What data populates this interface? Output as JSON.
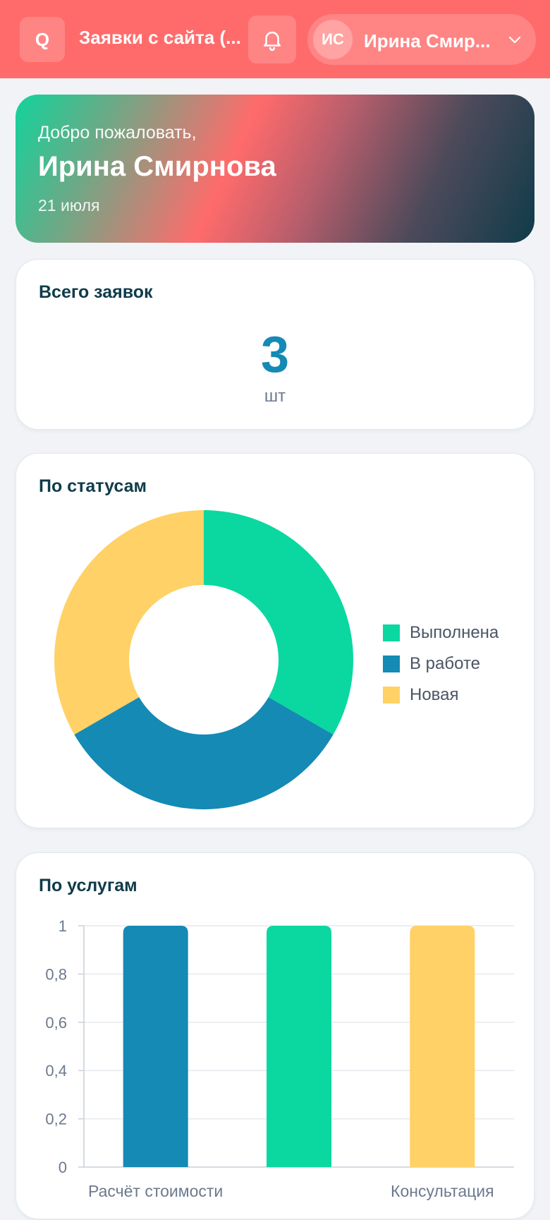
{
  "header": {
    "logo_letter": "Q",
    "title": "Заявки с сайта (...",
    "user_initials": "ИС",
    "user_name": "Ирина Смир..."
  },
  "welcome": {
    "greeting": "Добро пожаловать,",
    "name": "Ирина Смирнова",
    "date": "21 июля"
  },
  "total": {
    "title": "Всего заявок",
    "value": "3",
    "unit": "шт"
  },
  "status": {
    "title": "По статусам"
  },
  "services": {
    "title": "По услугам"
  },
  "colors": {
    "header_bg": "#ff6b6b",
    "green": "#0ad8a0",
    "blue": "#148ab5",
    "yellow": "#ffd166",
    "text_dark": "#0f3b4a"
  },
  "icons": [
    "bell-icon",
    "chevron-down-icon"
  ],
  "chart_data": [
    {
      "type": "pie",
      "title": "По статусам",
      "categories": [
        "Выполнена",
        "В работе",
        "Новая"
      ],
      "values": [
        1,
        1,
        1
      ],
      "colors": [
        "#0ad8a0",
        "#148ab5",
        "#ffd166"
      ],
      "legend": "right",
      "donut": true
    },
    {
      "type": "bar",
      "title": "По услугам",
      "categories": [
        "Расчёт стоимости",
        "",
        "Консультация"
      ],
      "values": [
        1,
        1,
        1
      ],
      "colors": [
        "#148ab5",
        "#0ad8a0",
        "#ffd166"
      ],
      "yticks": [
        "0",
        "0,2",
        "0,4",
        "0,6",
        "0,8",
        "1"
      ],
      "ylim": [
        0,
        1
      ],
      "grid": true
    }
  ]
}
